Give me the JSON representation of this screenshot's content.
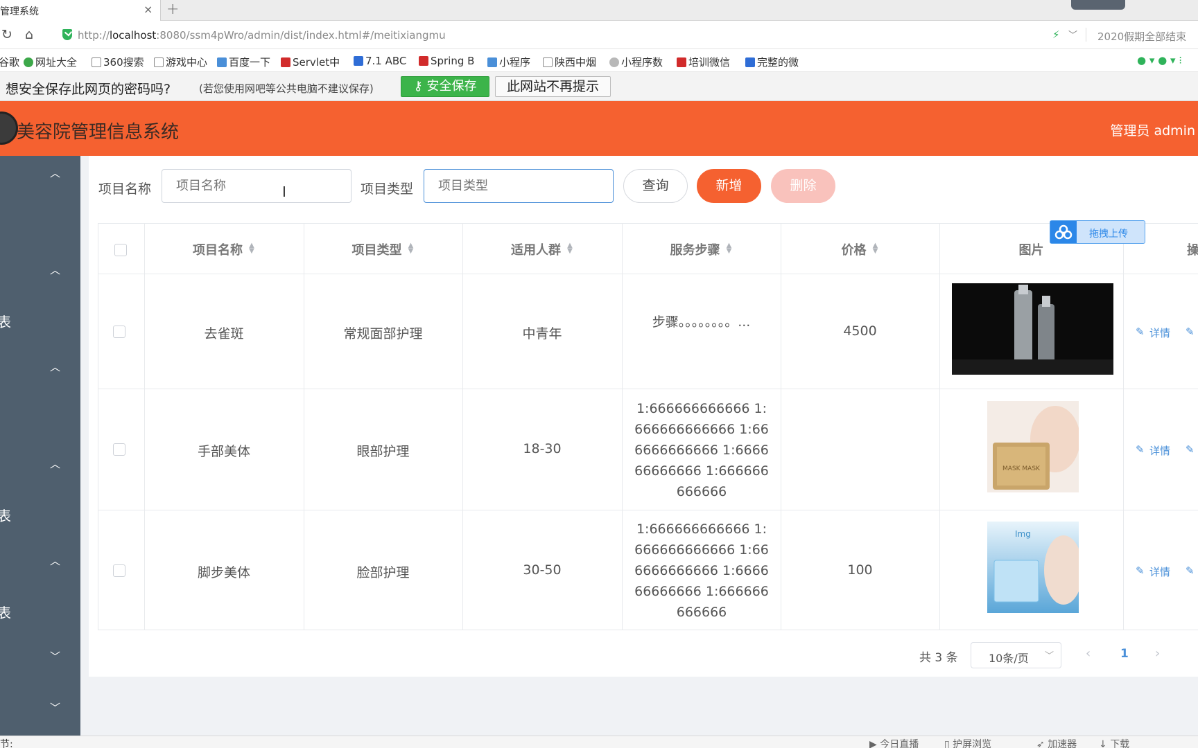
{
  "browser": {
    "tab_title": "管理系统",
    "tab_close": "×",
    "new_tab": "+",
    "url_scheme": "http://",
    "url_host": "localhost",
    "url_rest": ":8080/ssm4pWro/admin/dist/index.html#/meitixiangmu",
    "address_right_text": "2020假期全部结束",
    "bookmarks": [
      "谷歌",
      "网址大全",
      "360搜索",
      "游戏中心",
      "百度一下",
      "Servlet中",
      "7.1 ABC",
      "Spring B",
      "小程序",
      "陕西中烟",
      "小程序数",
      "培训微信",
      "完整的微"
    ],
    "password_prompt": {
      "question": "想安全保存此网页的密码吗?",
      "note": "(若您使用网吧等公共电脑不建议保存)",
      "save_label": "安全保存",
      "never_label": "此网站不再提示"
    },
    "status_left": "节:",
    "status_items": [
      "今日直播",
      "护屏浏览",
      "加速器",
      "下载"
    ]
  },
  "app": {
    "title": "美容院管理信息系统",
    "user": "管理员 admin"
  },
  "sidebar": {
    "labels": [
      "表",
      "表",
      "表"
    ]
  },
  "search": {
    "name_label": "项目名称",
    "name_placeholder": "项目名称",
    "type_label": "项目类型",
    "type_placeholder": "项目类型",
    "query_label": "查询",
    "add_label": "新增",
    "delete_label": "删除"
  },
  "upload_badge": "拖拽上传",
  "table": {
    "headers": [
      "项目名称",
      "项目类型",
      "适用人群",
      "服务步骤",
      "价格",
      "图片",
      "操"
    ],
    "detail_label": "详情",
    "rows": [
      {
        "name": "去雀斑",
        "type": "常规面部护理",
        "audience": "中青年",
        "steps": "步骤。。。。。。。。...",
        "price": "4500"
      },
      {
        "name": "手部美体",
        "type": "眼部护理",
        "audience": "18-30",
        "steps": "1:666666666666 1:666666666666 1:666666666666 1:666666666666 1:666666666666",
        "price": ""
      },
      {
        "name": "脚步美体",
        "type": "脸部护理",
        "audience": "30-50",
        "steps": "1:666666666666 1:666666666666 1:666666666666 1:666666666666 1:666666666666",
        "price": "100"
      }
    ]
  },
  "pagination": {
    "total": "共 3 条",
    "page_size": "10条/页",
    "current": "1"
  },
  "colors": {
    "accent": "#f56130",
    "sidebar": "#4f5f6e",
    "link": "#4a90d9"
  }
}
